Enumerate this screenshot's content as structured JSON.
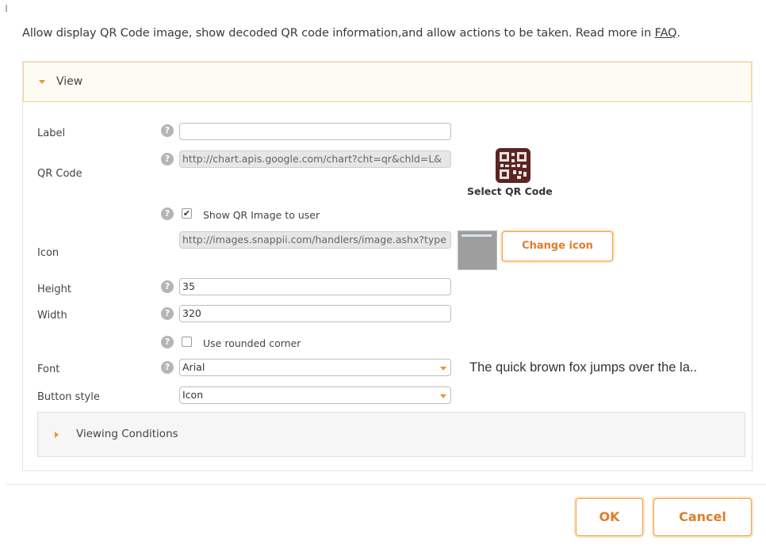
{
  "intro": {
    "text": "Allow display QR Code image, show decoded QR code information,and allow actions to be taken. Read more in ",
    "link": "FAQ",
    "suffix": "."
  },
  "view_section": {
    "title": "View",
    "expanded": true
  },
  "form": {
    "help_glyph": "?",
    "label": {
      "label": "Label",
      "value": ""
    },
    "qr_code": {
      "label": "QR Code",
      "value": "http://chart.apis.google.com/chart?cht=qr&chld=L&",
      "select_label": "Select QR Code",
      "icon": "qr-code-icon"
    },
    "show_qr": {
      "label": "Show QR Image to user",
      "checked": true,
      "check_glyph": "✔"
    },
    "icon": {
      "label": "Icon",
      "value": "http://images.snappii.com/handlers/image.ashx?type",
      "change_label": "Change icon"
    },
    "height": {
      "label": "Height",
      "value": "35"
    },
    "width": {
      "label": "Width",
      "value": "320"
    },
    "rounded": {
      "label": "Use rounded corner",
      "checked": false
    },
    "font": {
      "label": "Font",
      "value": "Arial",
      "preview": "The quick brown fox jumps over the la.."
    },
    "button_style": {
      "label": "Button style",
      "value": "Icon"
    }
  },
  "conditions_section": {
    "title": "Viewing Conditions",
    "expanded": false
  },
  "footer": {
    "ok_label": "OK",
    "cancel_label": "Cancel"
  },
  "colors": {
    "accent": "#e07d2a",
    "header_border": "#f0d98a",
    "header_bg": "#fdfbf3"
  }
}
